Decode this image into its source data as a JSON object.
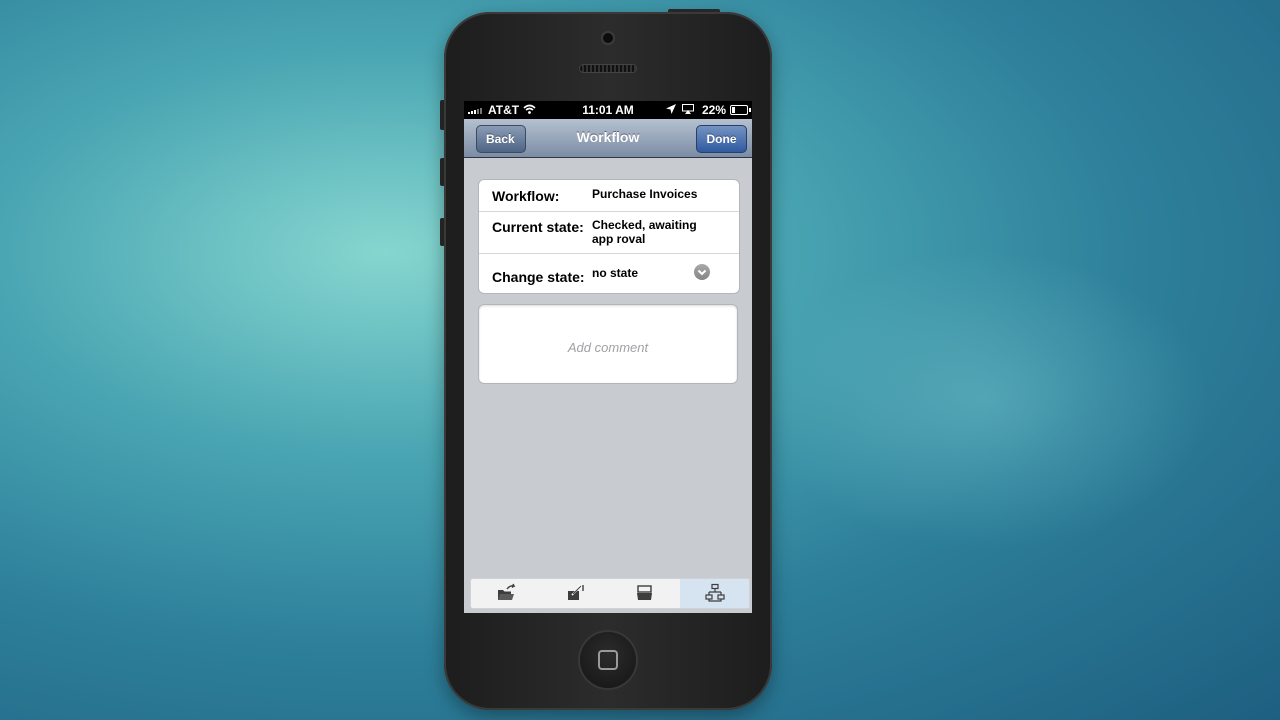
{
  "status_bar": {
    "carrier": "AT&T",
    "time": "11:01 AM",
    "battery": "22%",
    "icons": [
      "signal-bars-icon",
      "wifi-icon",
      "location-arrow-icon",
      "airplay-icon",
      "battery-icon"
    ]
  },
  "nav": {
    "back_label": "Back",
    "title": "Workflow",
    "done_label": "Done"
  },
  "form": {
    "workflow_label": "Workflow:",
    "workflow_value": "Purchase Invoices",
    "current_state_label": "Current state:",
    "current_state_value": "Checked, awaiting app roval",
    "change_state_label": "Change state:",
    "change_state_value": "no state"
  },
  "comment": {
    "placeholder": "Add comment"
  },
  "tabs": [
    {
      "icon": "open-folder-icon",
      "active": false
    },
    {
      "icon": "check-in-out-icon",
      "active": false
    },
    {
      "icon": "tray-icon",
      "active": false
    },
    {
      "icon": "workflow-hierarchy-icon",
      "active": true
    }
  ],
  "colors": {
    "nav_bar": "#7b8ca4",
    "done_button": "#2f5aa1",
    "active_tab": "#d6e3f1",
    "screen_bg": "#c8ccd0"
  }
}
